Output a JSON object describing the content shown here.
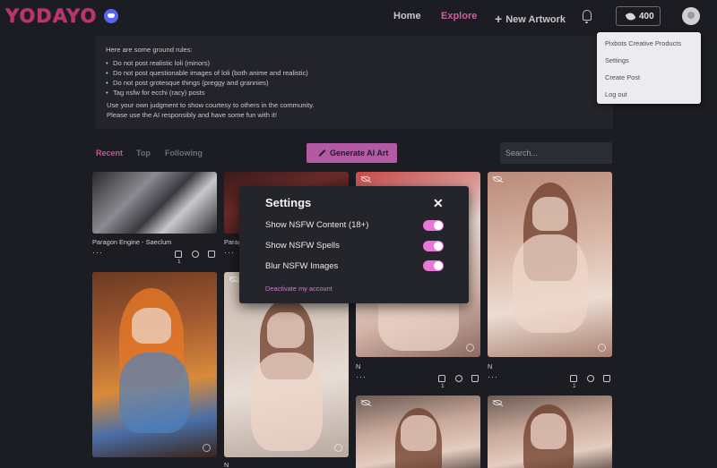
{
  "header": {
    "logo": "YODAYO",
    "nav": {
      "home": "Home",
      "explore": "Explore",
      "new_artwork": "New Artwork"
    },
    "credits": "400"
  },
  "menu": {
    "items": [
      "Pixbots Creative Products",
      "Settings",
      "Create Post",
      "Log out"
    ]
  },
  "rules": {
    "intro": "Here are some ground rules:",
    "items": [
      "Do not post realistic loli (minors)",
      "Do not post questionable images of loli (both anime and realistic)",
      "Do not post grotesque things (preggy and grannies)",
      "Tag nsfw for ecchi (racy) posts"
    ],
    "outro_1": "Use your own judgment to show courtesy to others in the community.",
    "outro_2": "Please use the AI responsibly and have some fun with it!"
  },
  "feed": {
    "tabs": [
      "Recent",
      "Top",
      "Following"
    ],
    "generate_label": "Generate AI Art",
    "search_placeholder": "Search..."
  },
  "cards": {
    "c1_title": "Paragon Engine - Saeclum",
    "c1_likes": "1",
    "c2_title": "Parag",
    "c4_title": "N",
    "c4_likes": "1",
    "c5_title": "N",
    "c5_likes": "1",
    "c7_title": "N"
  },
  "settings": {
    "title": "Settings",
    "close": "✕",
    "options": [
      "Show NSFW Content (18+)",
      "Show NSFW Spells",
      "Blur NSFW Images"
    ],
    "values": [
      true,
      true,
      true
    ],
    "deactivate": "Deactivate my account"
  },
  "colors": {
    "accent": "#d05ba2",
    "toggle_on": "#e777d8",
    "button": "#b25aa4"
  }
}
